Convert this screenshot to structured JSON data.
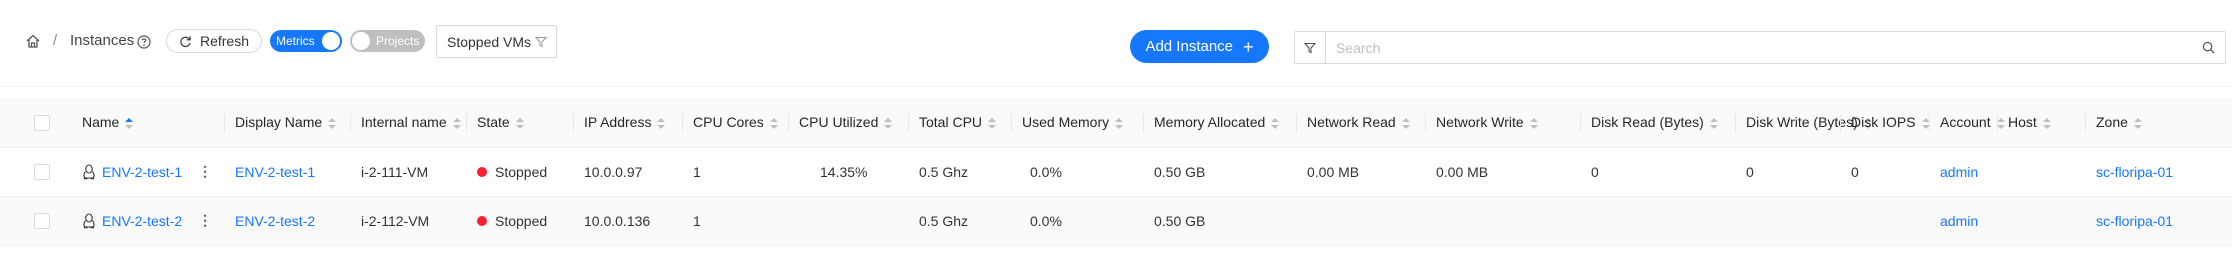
{
  "breadcrumb": {
    "separator": "/",
    "current": "Instances"
  },
  "toolbar": {
    "refresh_label": "Refresh",
    "metrics_label": "Metrics",
    "projects_label": "Projects",
    "filter_value": "Stopped VMs",
    "add_label": "Add Instance",
    "search_placeholder": "Search"
  },
  "table": {
    "columns": [
      "Name",
      "Display Name",
      "Internal name",
      "State",
      "IP Address",
      "CPU Cores",
      "CPU Utilized",
      "Total CPU",
      "Used Memory",
      "Memory Allocated",
      "Network Read",
      "Network Write",
      "Disk Read (Bytes)",
      "Disk Write (Bytes)",
      "Disk IOPS",
      "Account",
      "Host",
      "Zone"
    ],
    "sorted_column": "Name",
    "rows": [
      {
        "name": "ENV-2-test-1",
        "display_name": "ENV-2-test-1",
        "internal_name": "i-2-111-VM",
        "state": "Stopped",
        "ip": "10.0.0.97",
        "cpu_cores": "1",
        "cpu_utilized": "14.35%",
        "total_cpu": "0.5 Ghz",
        "used_memory": "0.0%",
        "memory_allocated": "0.50 GB",
        "network_read": "0.00 MB",
        "network_write": "0.00 MB",
        "disk_read": "0",
        "disk_write": "0",
        "disk_iops": "0",
        "account": "admin",
        "host": "",
        "zone": "sc-floripa-01"
      },
      {
        "name": "ENV-2-test-2",
        "display_name": "ENV-2-test-2",
        "internal_name": "i-2-112-VM",
        "state": "Stopped",
        "ip": "10.0.0.136",
        "cpu_cores": "1",
        "cpu_utilized": "",
        "total_cpu": "0.5 Ghz",
        "used_memory": "0.0%",
        "memory_allocated": "0.50 GB",
        "network_read": "",
        "network_write": "",
        "disk_read": "",
        "disk_write": "",
        "disk_iops": "",
        "account": "admin",
        "host": "",
        "zone": "sc-floripa-01"
      }
    ]
  },
  "colors": {
    "primary": "#1677ff",
    "stopped": "#f5222d",
    "switch_off": "#bfbfbf"
  },
  "icons": {
    "home": "home-icon",
    "help": "question-circle-icon",
    "refresh": "reload-icon",
    "filter": "filter-icon",
    "search": "search-icon",
    "os": "linux-penguin-icon",
    "row_menu": "more-vertical-icon"
  }
}
